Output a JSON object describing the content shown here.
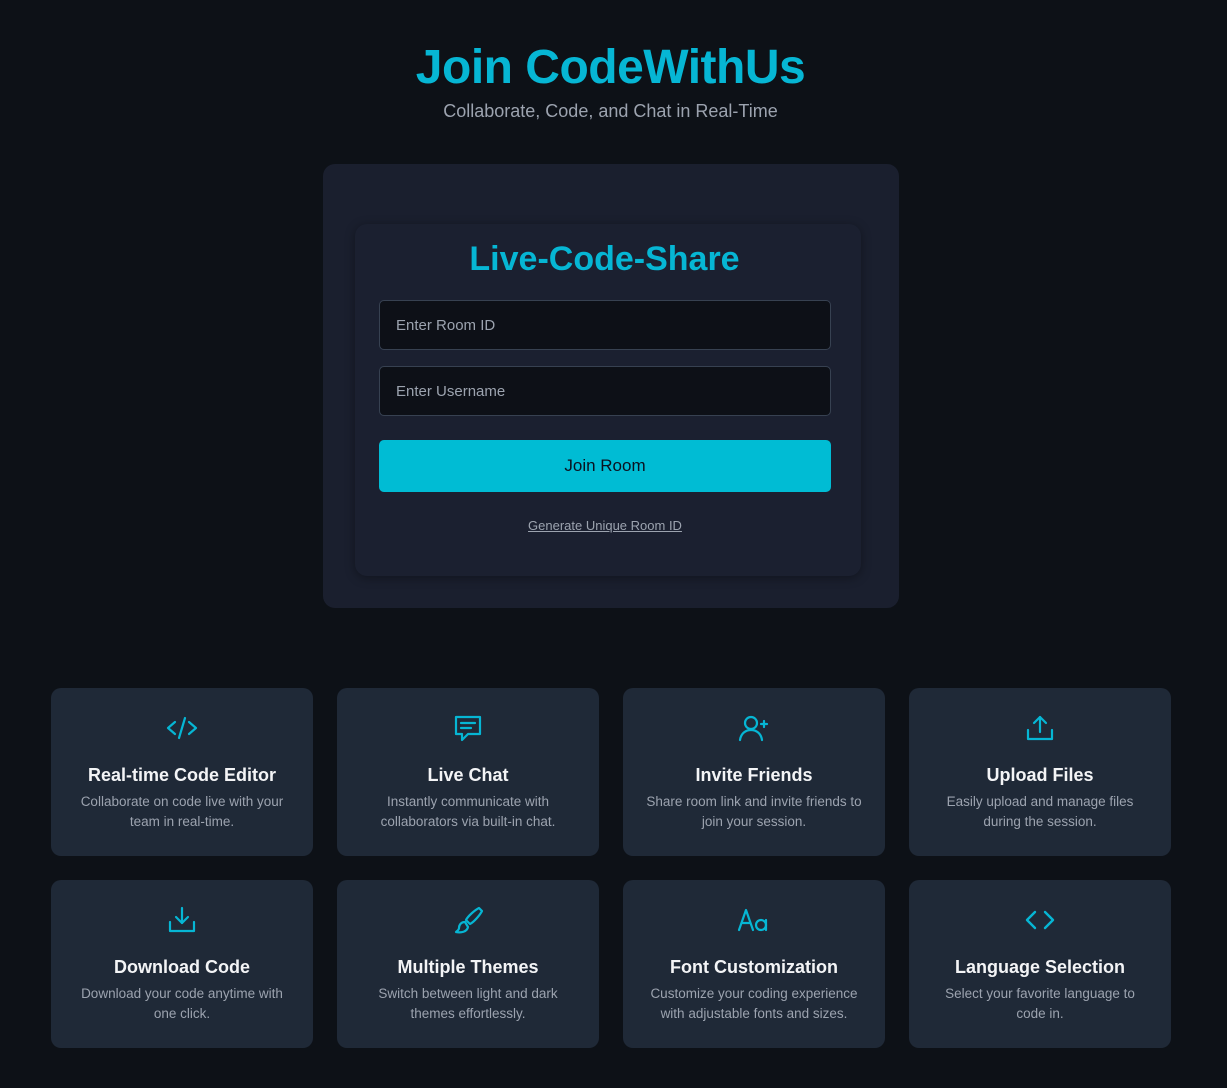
{
  "header": {
    "title": "Join CodeWithUs",
    "subtitle": "Collaborate, Code, and Chat in Real-Time"
  },
  "join_card": {
    "title": "Live-Code-Share",
    "room_id_placeholder": "Enter Room ID",
    "room_id_value": "",
    "username_placeholder": "Enter Username",
    "username_value": "",
    "join_button_label": "Join Room",
    "generate_link_label": "Generate Unique Room ID"
  },
  "colors": {
    "accent": "#06b6d4",
    "background": "#0d1117",
    "card": "#1f2937"
  },
  "features": [
    {
      "icon": "code-slash-icon",
      "title": "Real-time Code Editor",
      "description": "Collaborate on code live with your team in real-time."
    },
    {
      "icon": "chat-icon",
      "title": "Live Chat",
      "description": "Instantly communicate with collaborators via built-in chat."
    },
    {
      "icon": "user-plus-icon",
      "title": "Invite Friends",
      "description": "Share room link and invite friends to join your session."
    },
    {
      "icon": "upload-icon",
      "title": "Upload Files",
      "description": "Easily upload and manage files during the session."
    },
    {
      "icon": "download-icon",
      "title": "Download Code",
      "description": "Download your code anytime with one click."
    },
    {
      "icon": "brush-icon",
      "title": "Multiple Themes",
      "description": "Switch between light and dark themes effortlessly."
    },
    {
      "icon": "font-icon",
      "title": "Font Customization",
      "description": "Customize your coding experience with adjustable fonts and sizes."
    },
    {
      "icon": "code-brackets-icon",
      "title": "Language Selection",
      "description": "Select your favorite language to code in."
    }
  ]
}
